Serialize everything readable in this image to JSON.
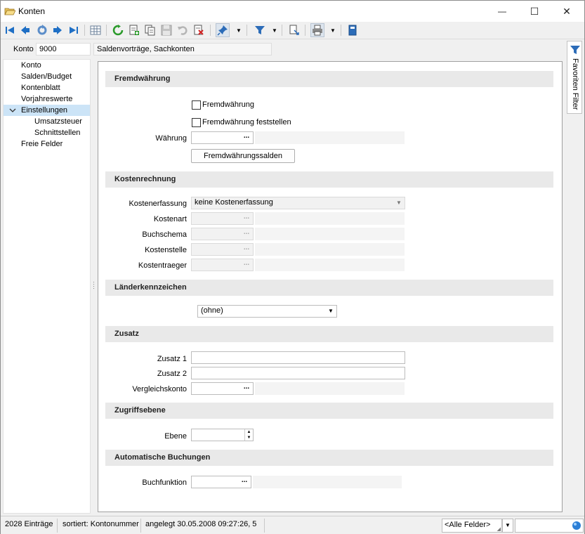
{
  "window": {
    "title": "Konten",
    "minimize_glyph": "—",
    "maximize_glyph": "☐",
    "close_glyph": "✕"
  },
  "toolbar": {
    "buttons": [
      "first-record",
      "previous-record",
      "refresh-record",
      "next-record",
      "last-record",
      "table-view",
      "reload",
      "new-record",
      "copy-record",
      "save-record",
      "undo",
      "delete-record",
      "pin",
      "filter",
      "export",
      "print",
      "calculator"
    ]
  },
  "konto": {
    "label": "Konto",
    "number": "9000",
    "description": "Saldenvorträge, Sachkonten"
  },
  "tree": {
    "items": [
      {
        "label": "Konto",
        "level": 0,
        "selected": false
      },
      {
        "label": "Salden/Budget",
        "level": 0,
        "selected": false
      },
      {
        "label": "Kontenblatt",
        "level": 0,
        "selected": false
      },
      {
        "label": "Vorjahreswerte",
        "level": 0,
        "selected": false
      },
      {
        "label": "Einstellungen",
        "level": 0,
        "selected": true,
        "expanded": true
      },
      {
        "label": "Umsatzsteuer",
        "level": 1,
        "selected": false
      },
      {
        "label": "Schnittstellen",
        "level": 1,
        "selected": false
      },
      {
        "label": "Freie Felder",
        "level": 0,
        "selected": false
      }
    ]
  },
  "sections": {
    "fremdwaehrung": {
      "title": "Fremdwährung",
      "checkbox1_label": "Fremdwährung",
      "checkbox1_checked": false,
      "checkbox2_label": "Fremdwährung feststellen",
      "checkbox2_checked": false,
      "waehrung_label": "Währung",
      "waehrung_value": "",
      "button_label": "Fremdwährungssalden"
    },
    "kostenrechnung": {
      "title": "Kostenrechnung",
      "erfassung_label": "Kostenerfassung",
      "erfassung_value": "keine Kostenerfassung",
      "kostenart_label": "Kostenart",
      "buchschema_label": "Buchschema",
      "kostenstelle_label": "Kostenstelle",
      "kostentraeger_label": "Kostentraeger"
    },
    "laender": {
      "title": "Länderkennzeichen",
      "value": "(ohne)"
    },
    "zusatz": {
      "title": "Zusatz",
      "zusatz1_label": "Zusatz 1",
      "zusatz1_value": "",
      "zusatz2_label": "Zusatz 2",
      "zusatz2_value": "",
      "vergleich_label": "Vergleichskonto",
      "vergleich_value": ""
    },
    "zugriff": {
      "title": "Zugriffsebene",
      "ebene_label": "Ebene",
      "ebene_value": ""
    },
    "auto": {
      "title": "Automatische Buchungen",
      "buchfunktion_label": "Buchfunktion",
      "buchfunktion_value": ""
    }
  },
  "dots_label": "...",
  "favorites": {
    "label": "Favoriten Filter"
  },
  "statusbar": {
    "count": "2028 Einträge",
    "sort": "sortiert: Kontonummer",
    "created": "angelegt 30.05.2008 09:27:26,  5",
    "field_filter": "<Alle Felder>",
    "search_value": ""
  },
  "colors": {
    "accent_blue": "#1f6fc5",
    "selection": "#cce4f7",
    "section_header": "#e9e9e9"
  }
}
